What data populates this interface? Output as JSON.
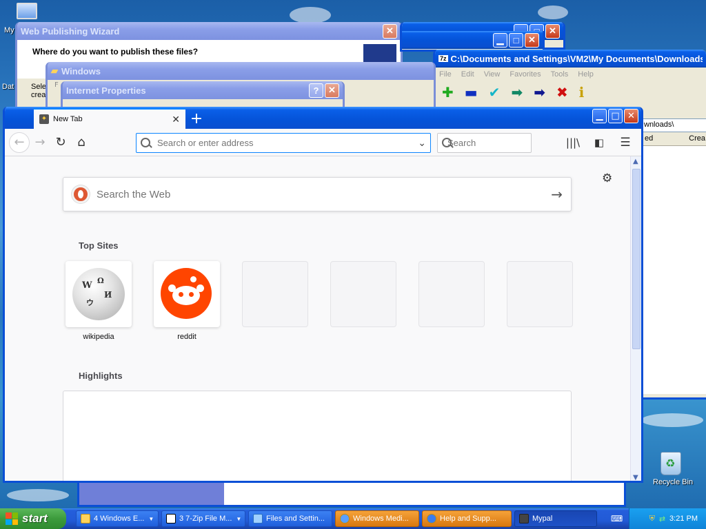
{
  "desktop": {
    "icons": {
      "my_computer": "My",
      "data": "Dat",
      "recycle_bin": "Recycle Bin"
    }
  },
  "bg_windows": {
    "web_wizard": {
      "title": "Web Publishing Wizard",
      "question": "Where do you want to publish these files?",
      "side_text_1": "Sele",
      "side_text_2": "crea"
    },
    "windows_explorer": {
      "title": "Windows",
      "fragment": "F"
    },
    "internet_properties": {
      "title": "Internet Properties"
    },
    "sevenzip": {
      "title": "C:\\Documents and Settings\\VM2\\My Documents\\Downloads\\",
      "menu": [
        "File",
        "Edit",
        "View",
        "Favorites",
        "Tools",
        "Help"
      ],
      "path_fragment": "wnloads\\",
      "col_ed": "ed",
      "col_crea": "Crea"
    }
  },
  "firefox": {
    "tab_title": "New Tab",
    "url_placeholder": "Search or enter address",
    "search_placeholder": "Search",
    "web_search_placeholder": "Search the Web",
    "top_sites_heading": "Top Sites",
    "highlights_heading": "Highlights",
    "top_sites": [
      {
        "label": "wikipedia"
      },
      {
        "label": "reddit"
      }
    ]
  },
  "taskbar": {
    "start_label": "start",
    "buttons": [
      {
        "label": "4 Windows E...",
        "style": "blue"
      },
      {
        "label": "3 7-Zip File M...",
        "style": "blue"
      },
      {
        "label": "Files and Settin...",
        "style": "blue"
      },
      {
        "label": "Windows Medi...",
        "style": "orange"
      },
      {
        "label": "Help and Supp...",
        "style": "orange"
      },
      {
        "label": "Mypal",
        "style": "active"
      }
    ],
    "clock": "3:21 PM"
  },
  "colors": {
    "xp_blue": "#0a4fd6",
    "reddit_orange": "#ff4500",
    "ddg_orange": "#de5833",
    "url_focus": "#0a84ff"
  }
}
